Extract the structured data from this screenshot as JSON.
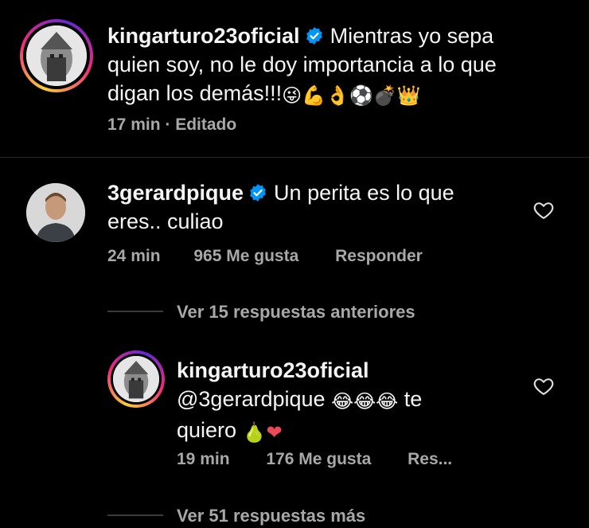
{
  "post": {
    "username": "kingarturo23oficial",
    "text_line1": "Mientras yo sepa",
    "text_line2": "quien soy, no le doy importancia a lo que",
    "text_line3": "digan los demás!!!",
    "emojis": [
      "😜",
      "💪",
      "👌",
      "⚽",
      "💣",
      "👑"
    ],
    "time": "17 min",
    "edited": "· Editado"
  },
  "comment": {
    "username": "3gerardpique",
    "text_line1": "Un perita es lo que",
    "text_line2": "eres.. culiao",
    "time": "24 min",
    "likes": "965 Me gusta",
    "reply_label": "Responder"
  },
  "view_previous": "Ver 15 respuestas anteriores",
  "reply": {
    "username": "kingarturo23oficial",
    "mention": "@3gerardpique",
    "emojis1": [
      "😂",
      "😂",
      "😂"
    ],
    "text_after": "te",
    "text_line3": "quiero",
    "emojis2": [
      "🍐",
      "❤"
    ],
    "time": "19 min",
    "likes": "176 Me gusta",
    "reply_label": "Res..."
  },
  "view_more": "Ver 51 respuestas más",
  "colors": {
    "background": "#000000",
    "text": "#f5f5f5",
    "secondary": "#a8a8a8",
    "verified": "#0095f6",
    "heart_red": "#ed4956"
  }
}
